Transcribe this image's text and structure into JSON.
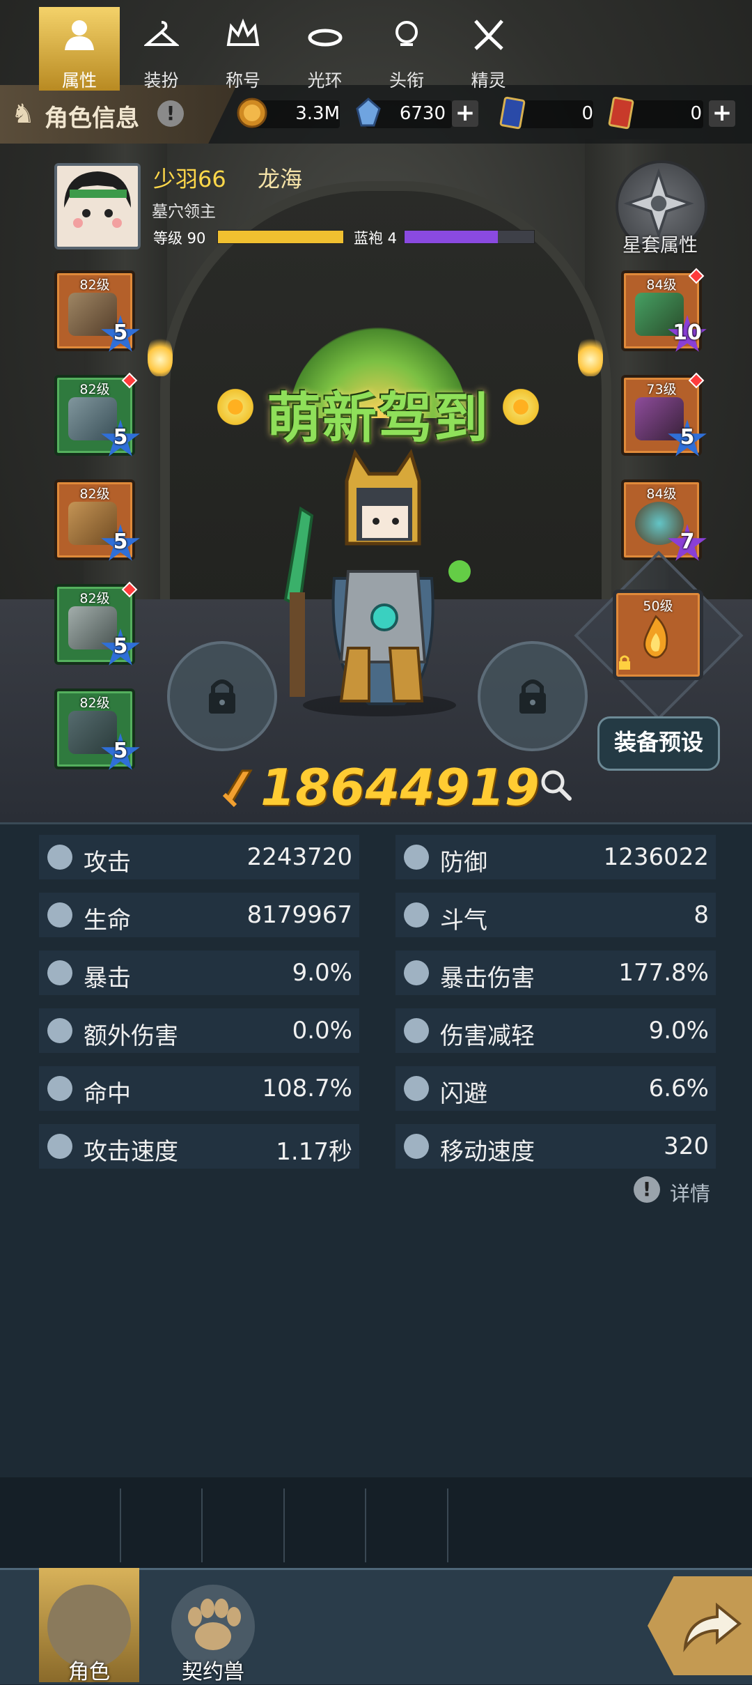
{
  "header": {
    "title": "角色信息",
    "info_icon": "exclamation-icon"
  },
  "resources": [
    {
      "name": "gold-coin",
      "value": "3.3M",
      "has_plus": false,
      "color": "#d08a22"
    },
    {
      "name": "crystal",
      "value": "6730",
      "has_plus": true,
      "color": "#6fa4e0"
    },
    {
      "name": "blue-card",
      "value": "0",
      "has_plus": false,
      "color": "#2a4aa8"
    },
    {
      "name": "red-card",
      "value": "0",
      "has_plus": true,
      "color": "#c83a2a"
    }
  ],
  "player": {
    "name": "少羽66",
    "guild": "龙海",
    "title": "墓穴领主",
    "level_label": "等级 90",
    "level_progress": 1.0,
    "robe_label": "蓝袍 4",
    "robe_progress": 0.72
  },
  "star_set": {
    "label": "星套属性"
  },
  "equipment_left": [
    {
      "level": "82级",
      "stars": "5",
      "frame": "orange",
      "gem": "blue",
      "alert": false
    },
    {
      "level": "82级",
      "stars": "5",
      "frame": "green",
      "gem": "blue",
      "alert": true
    },
    {
      "level": "82级",
      "stars": "5",
      "frame": "orange",
      "gem": "blue",
      "alert": false
    },
    {
      "level": "82级",
      "stars": "5",
      "frame": "green",
      "gem": "blue",
      "alert": true
    },
    {
      "level": "82级",
      "stars": "5",
      "frame": "green",
      "gem": "blue",
      "alert": false
    }
  ],
  "equipment_right": [
    {
      "level": "84级",
      "stars": "10",
      "frame": "orange",
      "gem": "purple",
      "alert": true
    },
    {
      "level": "73级",
      "stars": "5",
      "frame": "orange",
      "gem": "blue",
      "alert": true
    },
    {
      "level": "84级",
      "stars": "7",
      "frame": "orange",
      "gem": "purple",
      "alert": false
    }
  ],
  "pet_slot": {
    "level": "50级",
    "locked": true
  },
  "banner": {
    "text": "萌新驾到"
  },
  "preset_button": "装备预设",
  "power": {
    "value": "18644919"
  },
  "stats": [
    {
      "icon": "sword-icon",
      "name": "攻击",
      "value": "2243720"
    },
    {
      "icon": "shield-icon",
      "name": "防御",
      "value": "1236022"
    },
    {
      "icon": "heart-icon",
      "name": "生命",
      "value": "8179967"
    },
    {
      "icon": "swirl-icon",
      "name": "斗气",
      "value": "8"
    },
    {
      "icon": "crit-icon",
      "name": "暴击",
      "value": "9.0%"
    },
    {
      "icon": "burst-icon",
      "name": "暴击伤害",
      "value": "177.8%"
    },
    {
      "icon": "extra-damage-icon",
      "name": "额外伤害",
      "value": "0.0%"
    },
    {
      "icon": "damage-reduce-icon",
      "name": "伤害减轻",
      "value": "9.0%"
    },
    {
      "icon": "target-icon",
      "name": "命中",
      "value": "108.7%"
    },
    {
      "icon": "dodge-icon",
      "name": "闪避",
      "value": "6.6%"
    },
    {
      "icon": "attack-speed-icon",
      "name": "攻击速度",
      "value": "1.17秒"
    },
    {
      "icon": "move-speed-icon",
      "name": "移动速度",
      "value": "320"
    }
  ],
  "detail_link": "详情",
  "sub_tabs": [
    {
      "icon": "person-icon",
      "label": "属性",
      "active": true
    },
    {
      "icon": "hanger-icon",
      "label": "装扮",
      "active": false
    },
    {
      "icon": "crown-icon",
      "label": "称号",
      "active": false
    },
    {
      "icon": "halo-icon",
      "label": "光环",
      "active": false
    },
    {
      "icon": "skull-helmet-icon",
      "label": "头衔",
      "active": false
    },
    {
      "icon": "sprite-icon",
      "label": "精灵",
      "active": false
    }
  ],
  "bottom_tabs": [
    {
      "icon": "character-head-icon",
      "label": "角色",
      "active": true
    },
    {
      "icon": "paw-icon",
      "label": "契约兽",
      "active": false
    }
  ],
  "colors": {
    "gold_text": "#ffcc33",
    "level_bar": "#f0c030",
    "robe_bar": "#8a4ae0",
    "panel": "#223240"
  }
}
